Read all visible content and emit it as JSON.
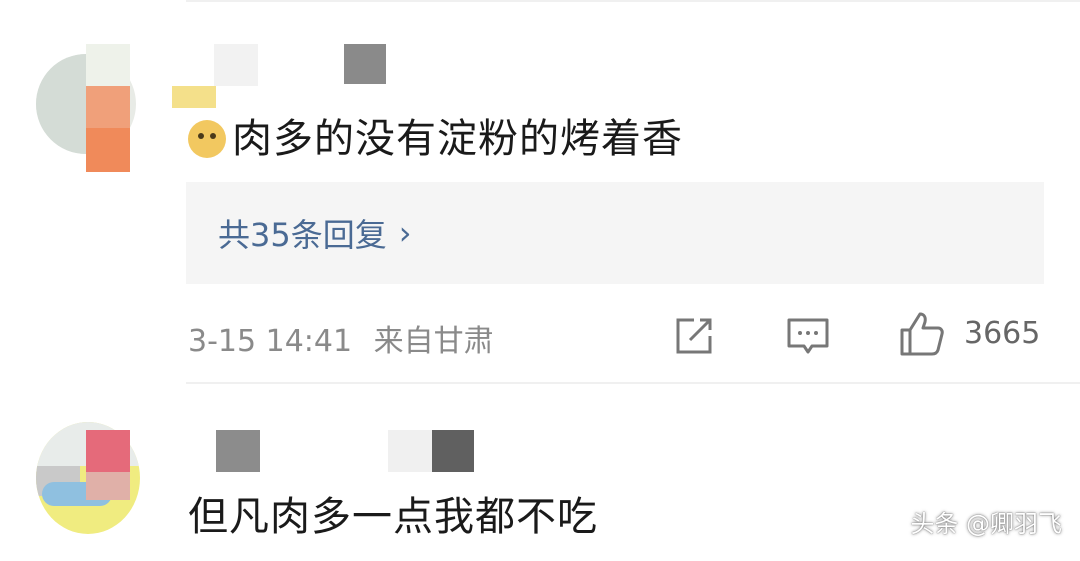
{
  "comment1": {
    "text": "肉多的没有淀粉的烤着香",
    "emoji": "doge-emoji",
    "replies_label": "共35条回复",
    "reply_chevron": "›",
    "timestamp": "3-15 14:41",
    "location": "来自甘肃",
    "like_count": "3665"
  },
  "comment2": {
    "text": "但凡肉多一点我都不吃"
  },
  "watermark": "头条 @卿羽飞",
  "colors": {
    "reply_link": "#4a6a94",
    "meta_text": "#8a8a8a",
    "reply_box_bg": "#f5f5f5"
  }
}
